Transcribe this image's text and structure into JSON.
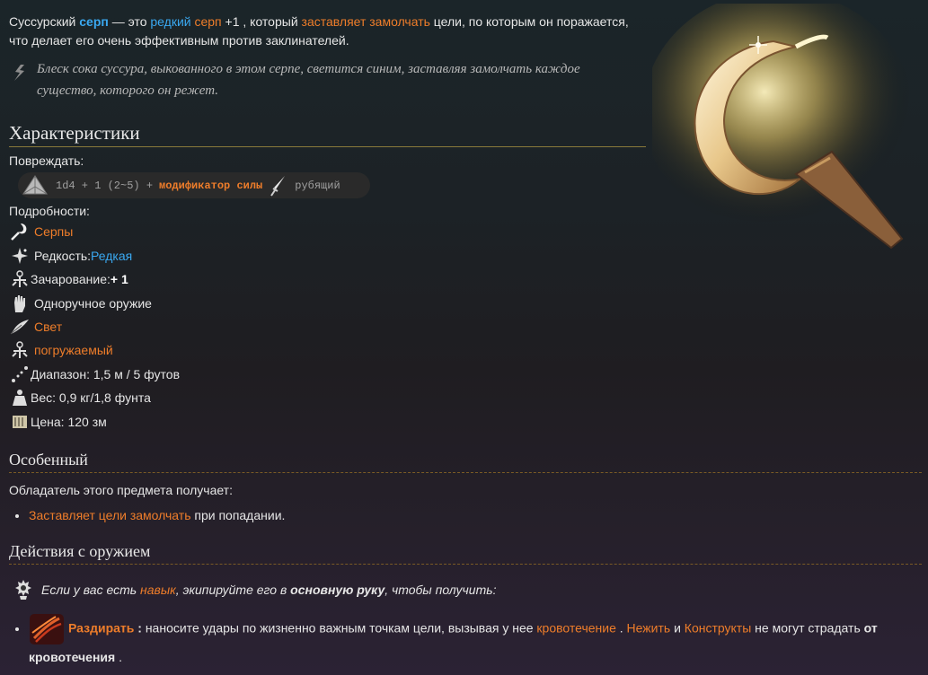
{
  "intro": {
    "p1": "Суссурский ",
    "item": "серп",
    "p2": " — это ",
    "rarity": "редкий",
    "p3": " ",
    "type": "серп",
    "plus": " +1",
    "p4": " , который ",
    "effect": "заставляет замолчать",
    "p5": " цели, по которым он поражается, что делает его очень эффективным против заклинателей."
  },
  "quote": "Блеск сока суссура, выкованного в этом серпе, светится синим, заставляя замолчать каждое существо, которого он режет.",
  "characteristics": {
    "title": "Характеристики",
    "damage_label": "Повреждать:",
    "damage_formula": "1d4 + 1 (2~5) +",
    "damage_modifier": "модификатор силы",
    "damage_type": "рубящий",
    "details_label": "Подробности:",
    "details": [
      {
        "icon": "sickle-icon",
        "text": "Серпы",
        "style": "link"
      },
      {
        "icon": "rarity-sparkle-icon",
        "label": "Редкость: ",
        "value": "Редкая"
      },
      {
        "icon": "enchantment-icon",
        "label": "Зачарование: ",
        "value": "+ 1"
      },
      {
        "icon": "hand-icon",
        "text": "Одноручное оружие",
        "style": "plain"
      },
      {
        "icon": "feather-icon",
        "text": "Свет",
        "style": "link"
      },
      {
        "icon": "dippable-icon",
        "text": "погружаемый",
        "style": "link"
      },
      {
        "icon": "range-icon",
        "text": "Диапазон: 1,5 м / 5 футов",
        "style": "plain"
      },
      {
        "icon": "weight-icon",
        "text": "Вес: 0,9 кг/1,8 фунта",
        "style": "plain"
      },
      {
        "icon": "price-icon",
        "text": "Цена: 120 зм",
        "style": "plain"
      }
    ]
  },
  "special": {
    "title": "Особенный",
    "intro": "Обладатель этого предмета получает:",
    "item_link": "Заставляет цели замолчать",
    "item_rest": " при попадании."
  },
  "actions": {
    "title": "Действия с оружием",
    "note_1": "Если у вас есть ",
    "note_link": "навык",
    "note_2": " , экипируйте его в ",
    "note_bold": "основную руку",
    "note_3": " , чтобы получить:",
    "action_name": "Раздирать",
    "action_colon": " : ",
    "action_text": "наносите удары по жизненно важным точкам цели, вызывая у нее ",
    "bleed_link": "кровотечение",
    "sep1": " . ",
    "undead_link": "Нежить",
    "and": " и ",
    "construct_link": "Конструкты",
    "cant": " не могут страдать ",
    "from_bleed": "от кровотечения",
    "end": " ."
  },
  "colors": {
    "link": "#ee7d2a",
    "rarity": "#3aa8f0",
    "background": "#1d2226"
  }
}
